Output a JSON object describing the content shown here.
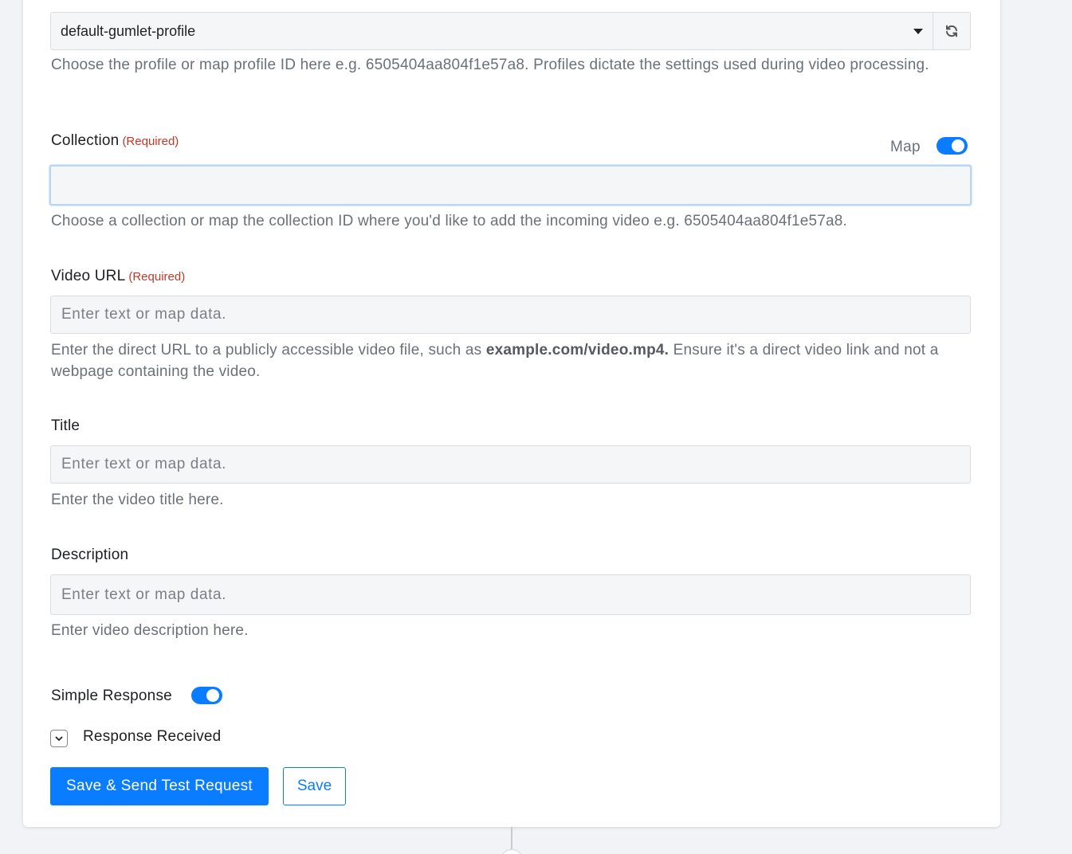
{
  "profile": {
    "selected_value": "default-gumlet-profile",
    "help": "Choose the profile or map profile ID here e.g. 6505404aa804f1e57a8. Profiles dictate the settings used during video processing."
  },
  "collection": {
    "label": "Collection",
    "required": "(Required)",
    "map_label": "Map",
    "map_enabled": true,
    "value": "",
    "help": "Choose a collection or map the collection ID where you'd like to add the incoming video e.g. 6505404aa804f1e57a8."
  },
  "video_url": {
    "label": "Video URL",
    "required": "(Required)",
    "placeholder": "Enter text or map data.",
    "help_prefix": "Enter the direct URL to a publicly accessible video file, such as ",
    "help_bold": "example.com/video.mp4.",
    "help_suffix": " Ensure it's a direct video link and not a webpage containing the video."
  },
  "title": {
    "label": "Title",
    "placeholder": "Enter text or map data.",
    "help": "Enter the video title here."
  },
  "description": {
    "label": "Description",
    "placeholder": "Enter text or map data.",
    "help": "Enter video description here."
  },
  "simple_response": {
    "label": "Simple Response",
    "enabled": true
  },
  "response_received": {
    "label": "Response Received"
  },
  "buttons": {
    "save_send": "Save & Send Test Request",
    "save": "Save"
  },
  "icons": {
    "dropdown": "caret-down-icon",
    "refresh": "refresh-icon",
    "expand": "chevron-down-icon"
  },
  "colors": {
    "accent": "#0a7cff",
    "required": "#c0392b"
  }
}
